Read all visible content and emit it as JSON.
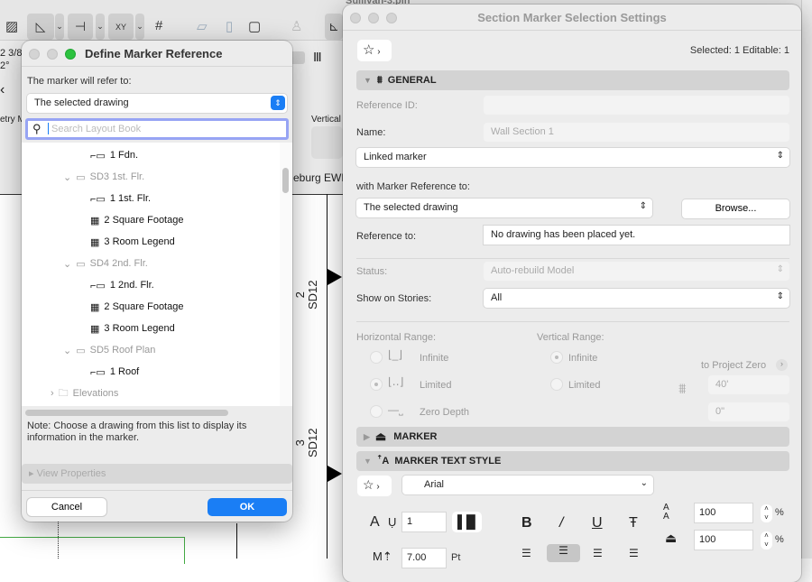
{
  "background": {
    "info_texts": {
      "dim": "2 3/8",
      "angle": "2°",
      "geometry": "etry M",
      "vertical": "Vertical",
      "layout_name": "eburg EWP"
    },
    "back_title": "Sullivan-3.pln",
    "drawing_markers": [
      {
        "number": "2",
        "sheet": "SD12"
      },
      {
        "number": "3",
        "sheet": "SD12"
      }
    ]
  },
  "define_dialog": {
    "title": "Define Marker Reference",
    "refer_label": "The marker will refer to:",
    "refer_value": "The selected drawing",
    "search_placeholder": "Search Layout Book",
    "tree": [
      {
        "label": "1 Fdn.",
        "type": "drawing"
      },
      {
        "label": "SD3 1st. Flr.",
        "type": "layout",
        "expanded": true
      },
      {
        "label": "1 1st. Flr.",
        "type": "drawing"
      },
      {
        "label": "2 Square Footage",
        "type": "schedule"
      },
      {
        "label": "3 Room Legend",
        "type": "schedule"
      },
      {
        "label": "SD4 2nd. Flr.",
        "type": "layout",
        "expanded": true
      },
      {
        "label": "1 2nd. Flr.",
        "type": "drawing"
      },
      {
        "label": "2 Square Footage",
        "type": "schedule"
      },
      {
        "label": "3 Room Legend",
        "type": "schedule"
      },
      {
        "label": "SD5 Roof Plan",
        "type": "layout",
        "expanded": true
      },
      {
        "label": "1 Roof",
        "type": "drawing"
      },
      {
        "label": "Elevations",
        "type": "folder",
        "expanded": false
      }
    ],
    "note": "Note: Choose a drawing from this list to display its information in the marker.",
    "view_properties": "View Properties",
    "cancel": "Cancel",
    "ok": "OK",
    "accent": "#1a7ef5"
  },
  "settings_window": {
    "title": "Section Marker Selection Settings",
    "selection_info": "Selected: 1 Editable: 1",
    "general": {
      "header": "GENERAL",
      "reference_id_label": "Reference ID:",
      "reference_id_value": "",
      "name_label": "Name:",
      "name_value": "Wall Section 1",
      "marker_type": "Linked marker",
      "marker_ref_label": "with Marker Reference to:",
      "marker_ref_value": "The selected drawing",
      "browse": "Browse...",
      "reference_to_label": "Reference to:",
      "reference_to_value": "No drawing has been placed yet.",
      "status_label": "Status:",
      "status_value": "Auto-rebuild Model",
      "stories_label": "Show on Stories:",
      "stories_value": "All",
      "horizontal_range_label": "Horizontal Range:",
      "horizontal_options": [
        "Infinite",
        "Limited",
        "Zero Depth"
      ],
      "horizontal_selected": "Limited",
      "vertical_range_label": "Vertical Range:",
      "vertical_options": [
        "Infinite",
        "Limited"
      ],
      "vertical_selected": "Infinite",
      "to_project_zero": "to Project Zero",
      "top_value": "40'",
      "bottom_value": "0\""
    },
    "marker_header": "MARKER",
    "text_style": {
      "header": "MARKER TEXT STYLE",
      "font": "Arial",
      "pen": "1",
      "size": "7.00",
      "size_unit": "Pt",
      "line_spacing": "100",
      "width_factor": "100",
      "percent": "%"
    }
  }
}
